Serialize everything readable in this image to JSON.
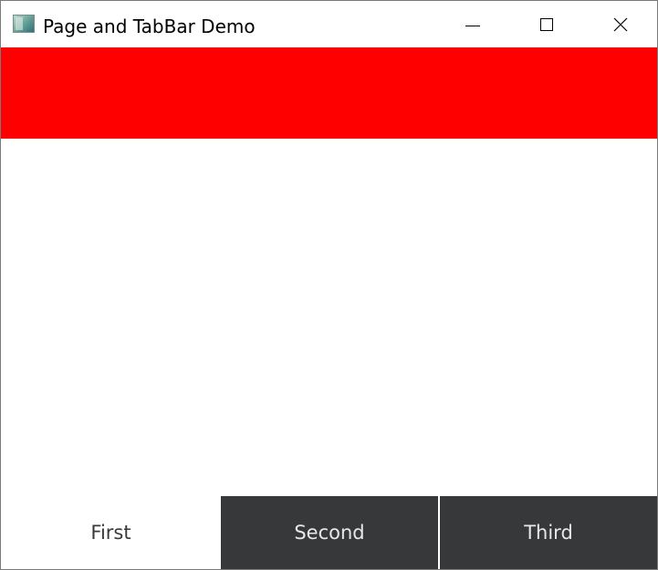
{
  "window": {
    "title": "Page and TabBar Demo",
    "app_icon": "app-window-icon",
    "controls": {
      "minimize": "minimize-icon",
      "maximize": "maximize-icon",
      "close": "close-icon"
    }
  },
  "page": {
    "header_color": "#ff0000",
    "background": "#ffffff"
  },
  "tabbar": {
    "active_index": 0,
    "active_bg": "#ffffff",
    "inactive_bg": "#37383a",
    "tabs": [
      {
        "label": "First"
      },
      {
        "label": "Second"
      },
      {
        "label": "Third"
      }
    ]
  }
}
